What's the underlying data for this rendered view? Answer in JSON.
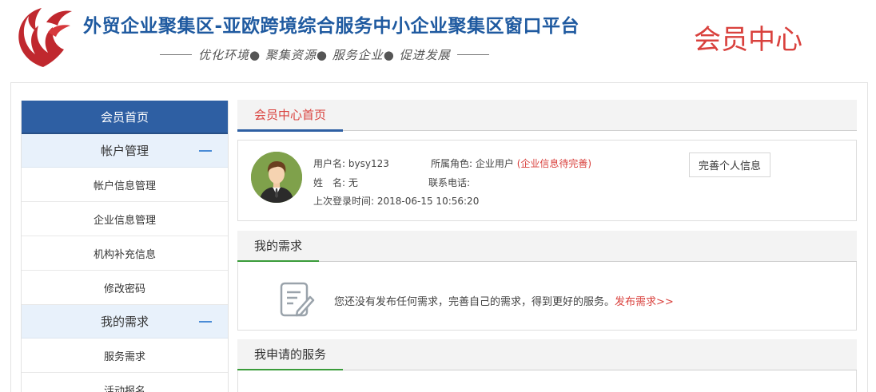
{
  "header": {
    "site_title": "外贸企业聚集区-亚欧跨境综合服务中小企业聚集区窗口平台",
    "slogan": "优化环境● 聚集资源● 服务企业● 促进发展",
    "member_center_title": "会员中心"
  },
  "sidebar": {
    "home": "会员首页",
    "groups": [
      {
        "label": "帐户管理",
        "items": [
          "帐户信息管理",
          "企业信息管理",
          "机构补充信息",
          "修改密码"
        ]
      },
      {
        "label": "我的需求",
        "items": [
          "服务需求",
          "活动报名"
        ]
      }
    ]
  },
  "main": {
    "home_tab": "会员中心首页",
    "profile": {
      "username_label": "用户名:",
      "username": "bysy123",
      "role_label": "所属角色:",
      "role": "企业用户",
      "role_status": "(企业信息待完善)",
      "name_label": "姓　名:",
      "name": "无",
      "phone_label": "联系电话:",
      "phone": "",
      "last_login_label": "上次登录时间:",
      "last_login": "2018-06-15 10:56:20",
      "complete_button": "完善个人信息"
    },
    "needs": {
      "title": "我的需求",
      "empty_text": "您还没有发布任何需求，完善自己的需求，得到更好的服务。",
      "publish_link": "发布需求>>"
    },
    "services": {
      "title": "我申请的服务"
    }
  },
  "colors": {
    "brand_blue": "#2e5fa3",
    "accent_red": "#d9413d",
    "accent_green": "#3a9c3a",
    "sidebar_group_bg": "#e8f1fb"
  }
}
